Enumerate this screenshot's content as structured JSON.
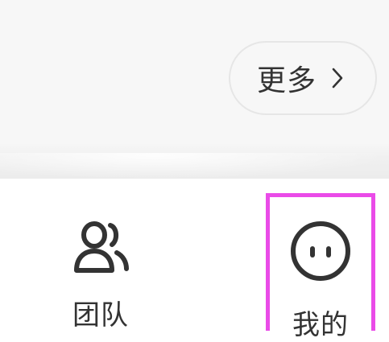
{
  "more_button": {
    "label": "更多",
    "icon": "chevron-right-icon"
  },
  "bottom_nav": {
    "tabs": [
      {
        "label": "团队",
        "icon": "team-people-icon",
        "selected": false
      },
      {
        "label": "我的",
        "icon": "profile-face-icon",
        "selected": true
      }
    ]
  },
  "colors": {
    "highlight_border": "#ea4be8",
    "text": "#333333",
    "top_background": "#f7f7f7"
  }
}
